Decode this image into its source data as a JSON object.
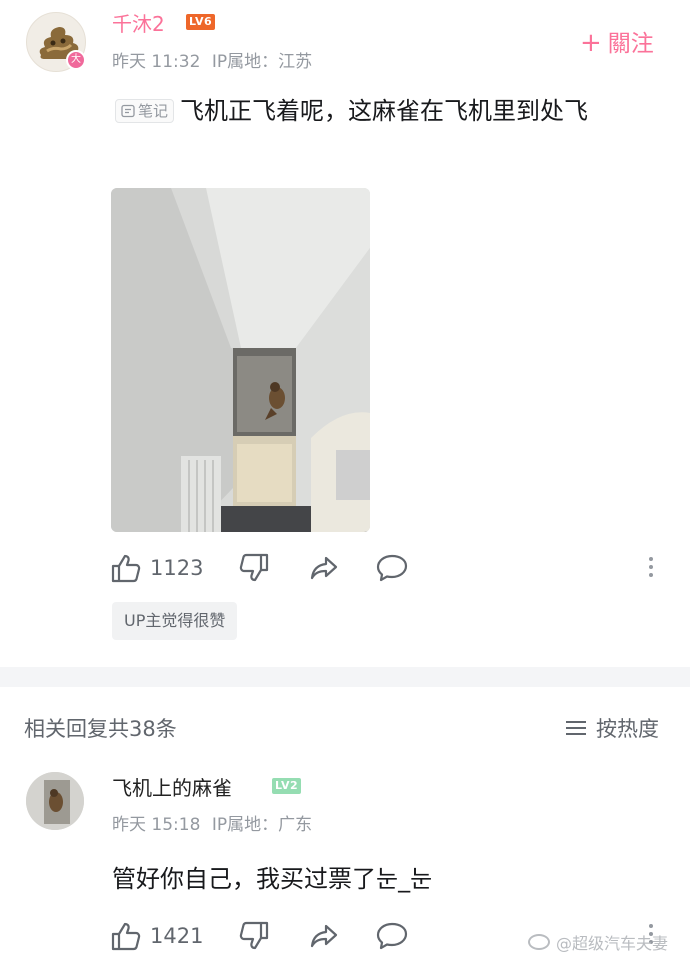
{
  "main_comment": {
    "username": "千沐2",
    "level": "LV6",
    "avatar_badge": "大",
    "time": "昨天 11:32",
    "ip_location": "IP属地：江苏",
    "follow_label": "關注",
    "note_tag": "笔记",
    "text": "飞机正飞着呢，这麻雀在飞机里到处飞",
    "likes": "1123",
    "up_badge": "UP主觉得很赞"
  },
  "replies_header": {
    "count_text": "相关回复共38条",
    "sort_label": "按热度"
  },
  "reply": {
    "username": "飞机上的麻雀",
    "level": "LV2",
    "time": "昨天 15:18",
    "ip_location": "IP属地：广东",
    "text": "管好你自己，我买过票了눈_눈",
    "likes": "1421"
  },
  "watermark": "@超级汽车夫妻",
  "icons": [
    "thumb-up-icon",
    "thumb-down-icon",
    "share-icon",
    "comment-icon",
    "more-icon",
    "sort-icon",
    "weibo-icon"
  ],
  "colors": {
    "accent_pink": "#fb7299",
    "lv6": "#ee672a",
    "lv2": "#95ddb2",
    "meta_gray": "#9499a0"
  }
}
